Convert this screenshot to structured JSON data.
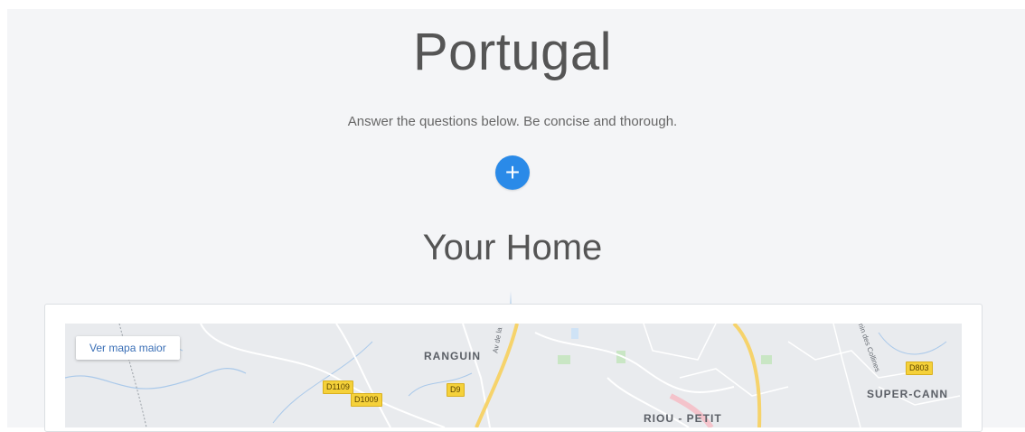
{
  "header": {
    "title": "Portugal",
    "subtitle": "Answer the questions below. Be concise and thorough.",
    "add_icon": "+"
  },
  "section": {
    "title": "Your Home"
  },
  "map": {
    "larger_map_label": "Ver mapa maior",
    "places": [
      "RANGUIN",
      "SUPER-CANN",
      "RIOU - PETIT"
    ],
    "roads": [
      "D1109",
      "D1009",
      "D9",
      "D803"
    ],
    "streets": [
      "Av de la",
      "Chemin des Collines"
    ]
  },
  "colors": {
    "background": "#f4f5f7",
    "accent": "#2a8ae8",
    "road_yellow": "#f5d13a",
    "link_blue": "#3a6fb6"
  }
}
